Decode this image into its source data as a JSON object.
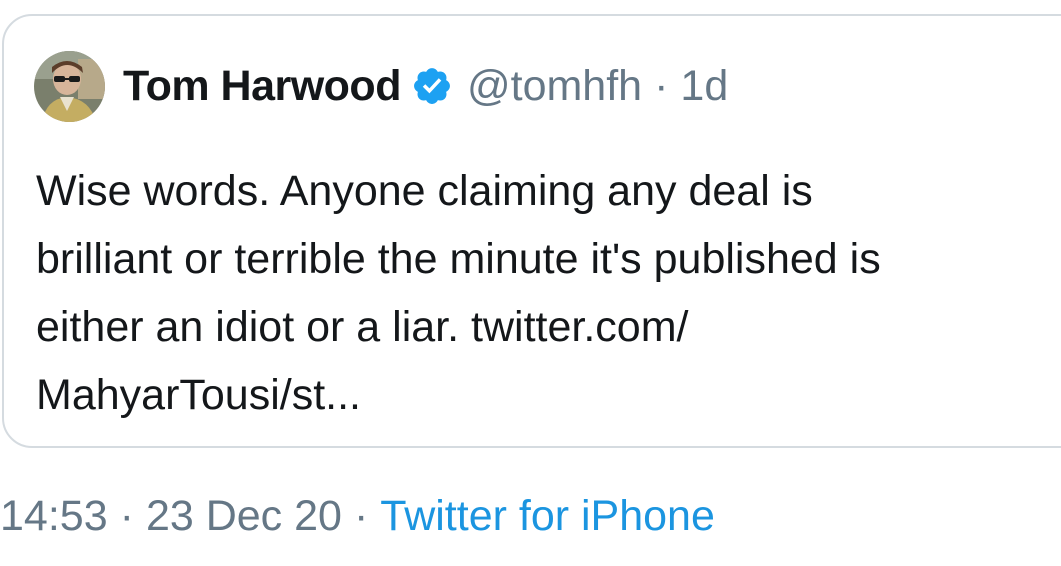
{
  "quoted_tweet": {
    "author": {
      "name": "Tom Harwood",
      "handle": "@tomhfh",
      "verified": true
    },
    "separator": "·",
    "age": "1d",
    "text": "Wise words. Anyone claiming any deal is\nbrilliant or terrible the minute it's published is\neither an idiot or a liar. twitter.com/\nMahyarTousi/st..."
  },
  "tweet_meta": {
    "time": "14:53",
    "separator": "·",
    "date": "23 Dec 20",
    "source": "Twitter for iPhone"
  },
  "colors": {
    "text_primary": "#14171a",
    "text_secondary": "#657786",
    "link": "#1b95e0",
    "verified_badge": "#1da1f2",
    "card_border": "#d5dbe0"
  },
  "icons": {
    "verified": "verified-badge-icon"
  }
}
